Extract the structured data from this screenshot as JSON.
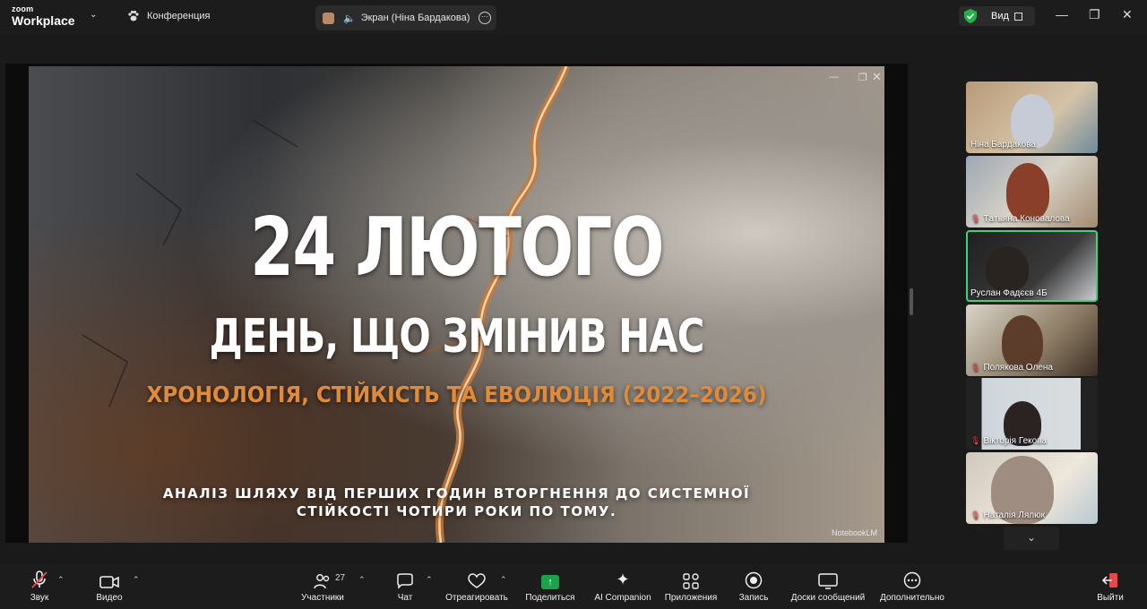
{
  "app": {
    "brand_small": "zoom",
    "brand_large": "Workplace"
  },
  "topbar": {
    "meeting_tab": "Конференция",
    "share_tab": "Экран (Ніна Бардакова)",
    "view_label": "Вид"
  },
  "slide": {
    "title": "24 ЛЮТОГО",
    "subtitle": "ДЕНЬ, ЩО ЗМІНИВ НАС",
    "tagline": "ХРОНОЛОГІЯ, СТІЙКІСТЬ ТА ЕВОЛЮЦІЯ (2022–2026)",
    "desc_line1": "АНАЛІЗ ШЛЯХУ ВІД ПЕРШИХ ГОДИН ВТОРГНЕННЯ ДО СИСТЕМНОЇ",
    "desc_line2": "СТІЙКОСТІ ЧОТИРИ РОКИ ПО ТОМУ.",
    "watermark": "NotebookLM"
  },
  "participants": [
    {
      "name": "Ніна Бардакова",
      "muted": false,
      "active": false
    },
    {
      "name": "Тaтьяна Коновалова",
      "muted": true,
      "active": false
    },
    {
      "name": "Руслан Фадєєв 4Б",
      "muted": false,
      "active": true
    },
    {
      "name": "Полякова Олена",
      "muted": true,
      "active": false
    },
    {
      "name": "Вікторія Гекова",
      "muted": true,
      "active": false
    },
    {
      "name": "Наталія Лялюк",
      "muted": true,
      "active": false
    }
  ],
  "toolbar": {
    "audio": "Звук",
    "video": "Видео",
    "participants": "Участники",
    "participants_count": "27",
    "chat": "Чат",
    "react": "Отреагировать",
    "share": "Поделиться",
    "ai": "AI Companion",
    "apps": "Приложения",
    "record": "Запись",
    "boards": "Доски сообщений",
    "more": "Дополнительно",
    "leave": "Выйти"
  },
  "colors": {
    "accent_green": "#36d67b",
    "share_green": "#1aa34a",
    "mute_red": "#e5484d",
    "tagline_orange": "#e08a3c"
  }
}
